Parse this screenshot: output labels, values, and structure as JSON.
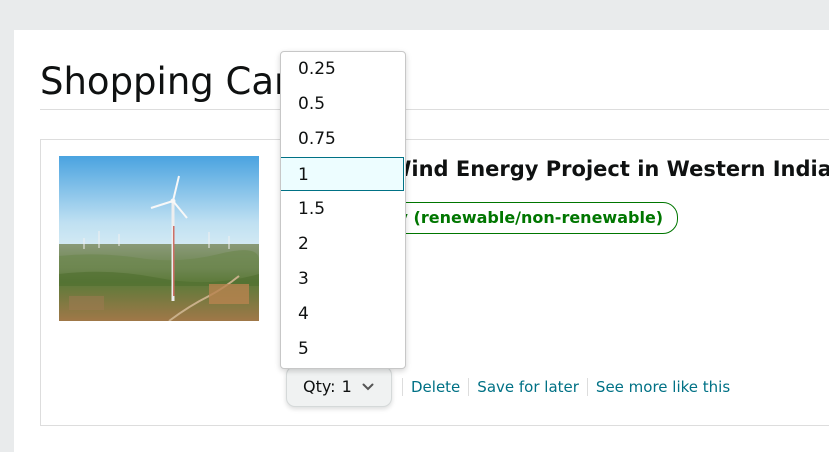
{
  "cart": {
    "title": "Shopping Cart"
  },
  "item": {
    "name": "Solar & Wind Energy Project in Western India",
    "badge": "Energy (renewable/non-renewable)",
    "image_icon": "wind-farm-photo"
  },
  "quantity": {
    "label": "Qty:",
    "value": "1",
    "options": [
      "0.25",
      "0.5",
      "0.75",
      "1",
      "1.5",
      "2",
      "3",
      "4",
      "5"
    ],
    "selected_index": 3
  },
  "actions": {
    "delete": "Delete",
    "save_for_later": "Save for later",
    "see_more": "See more like this"
  },
  "colors": {
    "link": "#007185",
    "badge": "#007600",
    "selected_option_bg": "#edfdff"
  }
}
